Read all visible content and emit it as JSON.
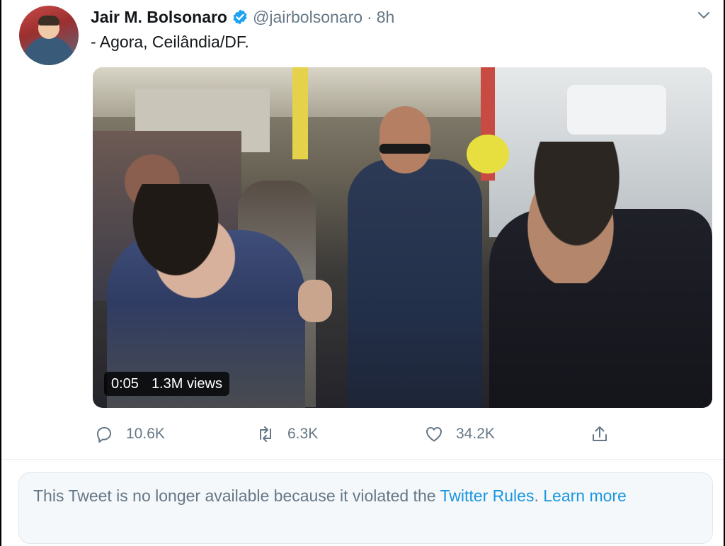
{
  "tweet": {
    "author": {
      "display_name": "Jair M. Bolsonaro",
      "verified": true,
      "handle": "@jairbolsonaro",
      "separator": "·",
      "time": "8h"
    },
    "text": "- Agora, Ceilândia/DF.",
    "media": {
      "type": "video",
      "duration": "0:05",
      "views": "1.3M views"
    },
    "actions": {
      "replies": "10.6K",
      "retweets": "6.3K",
      "likes": "34.2K"
    }
  },
  "notice": {
    "text_before": "This Tweet is no longer available because it violated the ",
    "rules_link": "Twitter Rules",
    "text_after": ". ",
    "learn_more": "Learn more"
  },
  "colors": {
    "link": "#1b95e0",
    "secondary_text": "#657786",
    "verified": "#1da1f2"
  },
  "icons": [
    "verified-badge-icon",
    "chevron-down-icon",
    "reply-icon",
    "retweet-icon",
    "like-icon",
    "share-icon"
  ]
}
